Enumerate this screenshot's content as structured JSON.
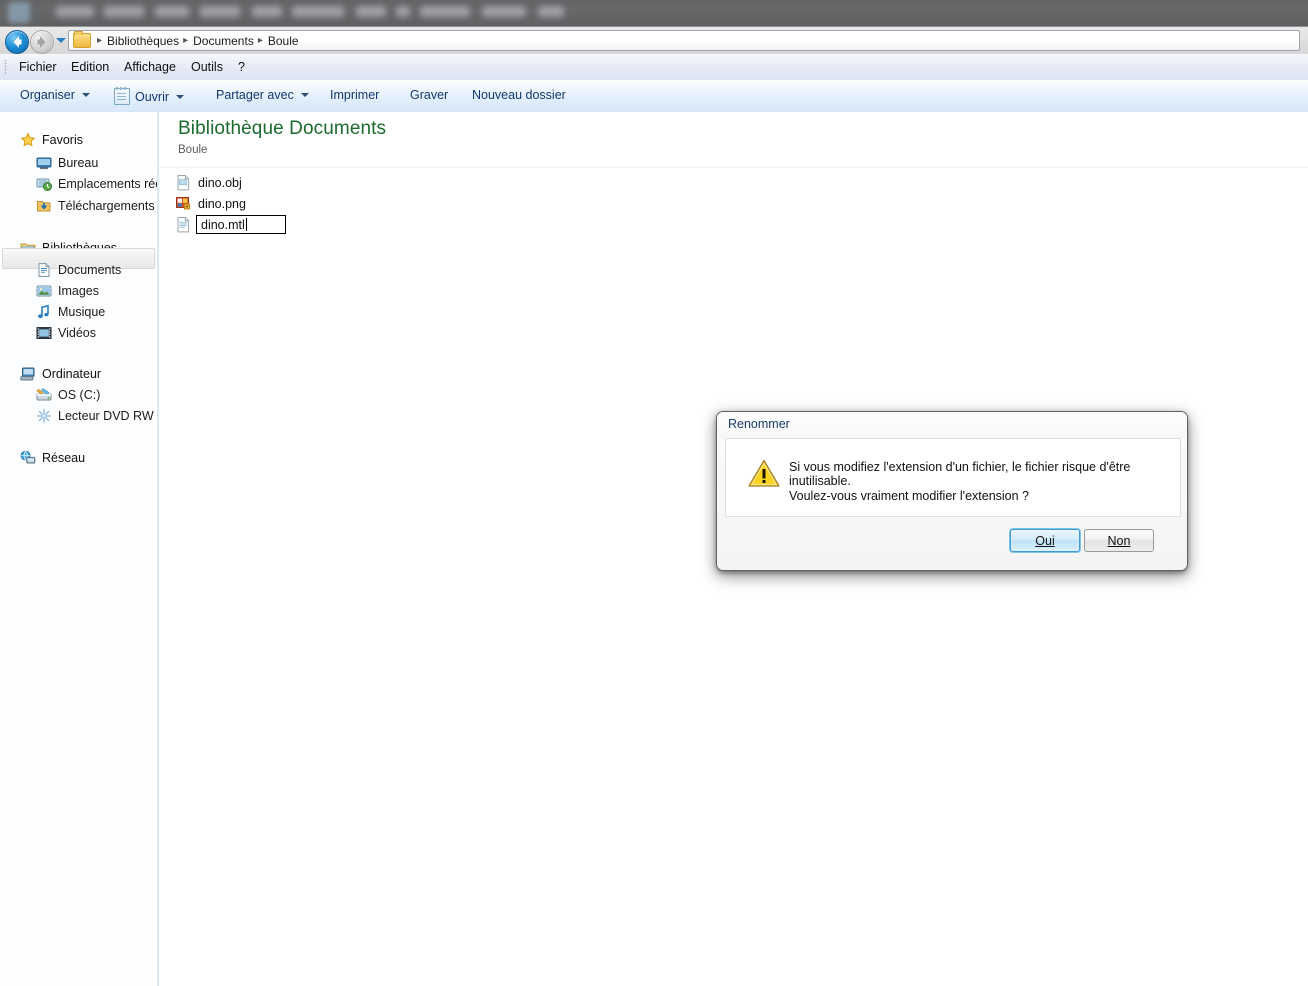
{
  "background_app": {
    "description": "blurred application menu bar behind the explorer window",
    "items": [
      "Fichier",
      "Edition",
      "Image",
      "Calque",
      "Texte",
      "Sélection",
      "Filtre",
      "3D",
      "Affichage",
      "Fenêtre",
      "Aide"
    ]
  },
  "navbar": {
    "back_icon": "back-arrow-icon",
    "forward_icon": "forward-arrow-icon",
    "history_dropdown_icon": "chevron-down-icon",
    "folder_icon": "folder-icon",
    "breadcrumbs": [
      "Bibliothèques",
      "Documents",
      "Boule"
    ],
    "separator": "▸"
  },
  "menubar": {
    "items": [
      "Fichier",
      "Edition",
      "Affichage",
      "Outils",
      "?"
    ]
  },
  "toolbar": {
    "items": [
      {
        "label": "Organiser",
        "has_caret": true,
        "icon": null
      },
      {
        "label": "Ouvrir",
        "has_caret": true,
        "icon": "notepad-icon"
      },
      {
        "label": "Partager avec",
        "has_caret": true,
        "icon": null
      },
      {
        "label": "Imprimer",
        "has_caret": false,
        "icon": null
      },
      {
        "label": "Graver",
        "has_caret": false,
        "icon": null
      },
      {
        "label": "Nouveau dossier",
        "has_caret": false,
        "icon": null
      }
    ]
  },
  "sidebar": {
    "groups": [
      {
        "header": {
          "label": "Favoris",
          "icon": "star-icon"
        },
        "items": [
          {
            "label": "Bureau",
            "icon": "desktop-icon"
          },
          {
            "label": "Emplacements récer",
            "icon": "recent-places-icon"
          },
          {
            "label": "Téléchargements",
            "icon": "downloads-icon"
          }
        ]
      },
      {
        "header": {
          "label": "Bibliothèques",
          "icon": "libraries-icon"
        },
        "items": [
          {
            "label": "Documents",
            "icon": "documents-icon",
            "selected": true
          },
          {
            "label": "Images",
            "icon": "pictures-icon"
          },
          {
            "label": "Musique",
            "icon": "music-icon"
          },
          {
            "label": "Vidéos",
            "icon": "videos-icon"
          }
        ]
      },
      {
        "header": {
          "label": "Ordinateur",
          "icon": "computer-icon"
        },
        "items": [
          {
            "label": "OS (C:)",
            "icon": "harddrive-icon"
          },
          {
            "label": "Lecteur DVD RW (E:)",
            "icon": "dvd-drive-icon"
          }
        ]
      },
      {
        "header": {
          "label": "Réseau",
          "icon": "network-icon"
        },
        "items": []
      }
    ]
  },
  "content": {
    "library_title": "Bibliothèque Documents",
    "library_subtitle": "Boule",
    "files": [
      {
        "name": "dino.obj",
        "icon": "generic-file-icon",
        "renaming": false
      },
      {
        "name": "dino.png",
        "icon": "png-image-icon",
        "renaming": false
      },
      {
        "name": "dino.mtl",
        "icon": "text-file-icon",
        "renaming": true
      }
    ]
  },
  "dialog": {
    "title": "Renommer",
    "warning_icon": "warning-triangle-icon",
    "line1": "Si vous modifiez l'extension d'un fichier, le fichier risque d'être inutilisable.",
    "line2": "Voulez-vous vraiment modifier l'extension ?",
    "buttons": [
      {
        "label": "Oui",
        "accesskey": "O",
        "default": true
      },
      {
        "label": "Non",
        "accesskey": "N",
        "default": false
      }
    ]
  },
  "colors": {
    "library_title_green": "#1b6b2e",
    "toolbar_text_blue": "#14386b",
    "dialog_title_blue": "#1a3c6b",
    "default_button_border": "#3c9bd4",
    "warning_yellow": "#ffcc00",
    "nav_back_blue": "#1e8fd8"
  }
}
